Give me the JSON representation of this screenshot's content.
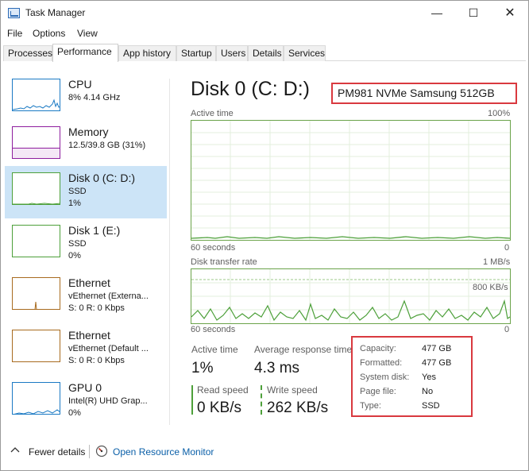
{
  "window": {
    "title": "Task Manager"
  },
  "controls": {
    "minimize": "—",
    "maximize": "☐",
    "close": "✕"
  },
  "menu": [
    "File",
    "Options",
    "View"
  ],
  "tabs": [
    "Processes",
    "Performance",
    "App history",
    "Startup",
    "Users",
    "Details",
    "Services"
  ],
  "active_tab": "Performance",
  "sidebar": [
    {
      "title": "CPU",
      "lines": [
        "8%  4.14 GHz"
      ],
      "color": "#1b7ac4"
    },
    {
      "title": "Memory",
      "lines": [
        "12.5/39.8 GB (31%)"
      ],
      "color": "#8e1e9e"
    },
    {
      "title": "Disk 0 (C: D:)",
      "lines": [
        "SSD",
        "1%"
      ],
      "color": "#4da03a",
      "selected": true
    },
    {
      "title": "Disk 1 (E:)",
      "lines": [
        "SSD",
        "0%"
      ],
      "color": "#4da03a"
    },
    {
      "title": "Ethernet",
      "lines": [
        "vEthernet (Externa...",
        "S: 0  R: 0 Kbps"
      ],
      "color": "#a86b1f"
    },
    {
      "title": "Ethernet",
      "lines": [
        "vEthernet (Default ...",
        "S: 0  R: 0 Kbps"
      ],
      "color": "#a86b1f"
    },
    {
      "title": "GPU 0",
      "lines": [
        "Intel(R) UHD Grap...",
        "0%"
      ],
      "color": "#1b7ac4"
    }
  ],
  "main": {
    "heading": "Disk 0 (C: D:)",
    "model": "PM981 NVMe Samsung 512GB",
    "active_chart": {
      "label": "Active time",
      "max": "100%",
      "time": "60 seconds",
      "min": "0",
      "color": "#4da03a"
    },
    "transfer_chart": {
      "label": "Disk transfer rate",
      "max": "1 MB/s",
      "mark": "800 KB/s",
      "time": "60 seconds",
      "min": "0",
      "color": "#4da03a"
    },
    "stats": {
      "active_time_label": "Active time",
      "active_time_value": "1%",
      "response_label": "Average response time",
      "response_value": "4.3 ms",
      "read_label": "Read speed",
      "read_value": "0 KB/s",
      "write_label": "Write speed",
      "write_value": "262 KB/s"
    },
    "properties": [
      {
        "key": "Capacity:",
        "value": "477 GB"
      },
      {
        "key": "Formatted:",
        "value": "477 GB"
      },
      {
        "key": "System disk:",
        "value": "Yes"
      },
      {
        "key": "Page file:",
        "value": "No"
      },
      {
        "key": "Type:",
        "value": "SSD"
      }
    ]
  },
  "footer": {
    "fewer_details": "Fewer details",
    "resource_monitor": "Open Resource Monitor"
  },
  "colors": {
    "accent_link": "#0a5fa8",
    "highlight_box": "#d9393f",
    "selected_bg": "#cce4f7"
  }
}
